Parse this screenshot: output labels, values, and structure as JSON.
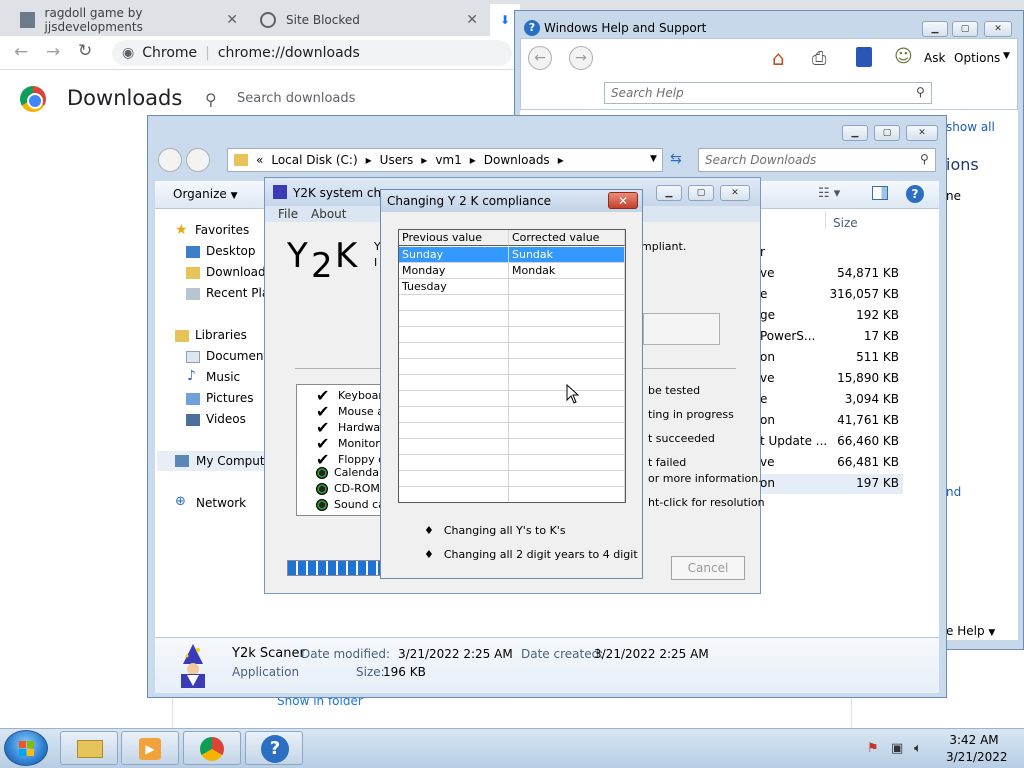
{
  "chrome": {
    "tabs": [
      {
        "title": "ragdoll game by jjsdevelopments"
      },
      {
        "title": "Site Blocked"
      }
    ],
    "omnibox_label": "Chrome",
    "omnibox_url": "chrome://downloads",
    "page_title": "Downloads",
    "search_placeholder": "Search downloads",
    "show_in_folder": "Show in folder"
  },
  "help": {
    "title": "Windows Help and Support",
    "ask": "Ask",
    "options": "Options",
    "search_placeholder": "Search Help",
    "link_show_all": "show all",
    "heading_partial": "ions",
    "text_partial": "ne",
    "link_partial": "nd",
    "help_menu": "e Help"
  },
  "explorer": {
    "breadcrumb": [
      "«",
      "Local Disk (C:)",
      "Users",
      "vm1",
      "Downloads"
    ],
    "search_placeholder": "Search Downloads",
    "organize": "Organize",
    "size_header": "Size",
    "nav": {
      "favorites": "Favorites",
      "desktop": "Desktop",
      "downloads": "Downloads",
      "recent": "Recent Plac",
      "libraries": "Libraries",
      "documents": "Document",
      "music": "Music",
      "pictures": "Pictures",
      "videos": "Videos",
      "computer": "My Compute",
      "network": "Network"
    },
    "rows": [
      {
        "type": "r",
        "size": ""
      },
      {
        "type": "ve",
        "size": "54,871 KB"
      },
      {
        "type": "e",
        "size": "316,057 KB"
      },
      {
        "type": "ge",
        "size": "192 KB"
      },
      {
        "type": "PowerS...",
        "size": "17 KB"
      },
      {
        "type": "on",
        "size": "511 KB"
      },
      {
        "type": "ve",
        "size": "15,890 KB"
      },
      {
        "type": "e",
        "size": "3,094 KB"
      },
      {
        "type": "on",
        "size": "41,761 KB"
      },
      {
        "type": "t Update ...",
        "size": "66,460 KB"
      },
      {
        "type": "ve",
        "size": "66,481 KB"
      },
      {
        "type": "on",
        "size": "197 KB"
      }
    ],
    "details": {
      "name": "Y2k Scaner",
      "kind": "Application",
      "modified_label": "Date modified:",
      "modified_value": "3/21/2022 2:25 AM",
      "created_label": "Date created:",
      "created_value": "3/21/2022 2:25 AM",
      "size_label": "Size:",
      "size_value": "196 KB"
    }
  },
  "y2k": {
    "title": "Y2K system chec",
    "menu_file": "File",
    "menu_about": "About",
    "logo_y": "Y",
    "logo_2": "2",
    "logo_k": "K",
    "side_y": "Y",
    "side_l": "I",
    "compliant": "mpliant.",
    "checklist": [
      {
        "label": "Keyboar",
        "state": "check"
      },
      {
        "label": "Mouse a",
        "state": "check"
      },
      {
        "label": "Hardwar",
        "state": "check"
      },
      {
        "label": "Monitor a",
        "state": "check"
      },
      {
        "label": "Floppy dr",
        "state": "check"
      },
      {
        "label": "Calendar",
        "state": "dot"
      },
      {
        "label": "CD-ROM",
        "state": "dot"
      },
      {
        "label": "Sound ca",
        "state": "dot"
      }
    ],
    "legend": [
      "be tested",
      "ting in progress",
      "t succeeded",
      "t failed",
      "or more information.",
      "ht-click for resolution"
    ],
    "cancel": "Cancel"
  },
  "dialog": {
    "title": "Changing Y 2 K compliance",
    "close": "✕",
    "col_prev": "Previous value",
    "col_corr": "Corrected value",
    "rows": [
      {
        "prev": "Sunday",
        "corr": "Sundak"
      },
      {
        "prev": "Monday",
        "corr": "Mondak"
      },
      {
        "prev": "Tuesday",
        "corr": ""
      }
    ],
    "bullet1": "Changing all Y's to K's",
    "bullet2": "Changing all 2 digit years to 4 digit",
    "bullet_glyph": "♦"
  },
  "taskbar": {
    "time": "3:42 AM",
    "date": "3/21/2022"
  }
}
